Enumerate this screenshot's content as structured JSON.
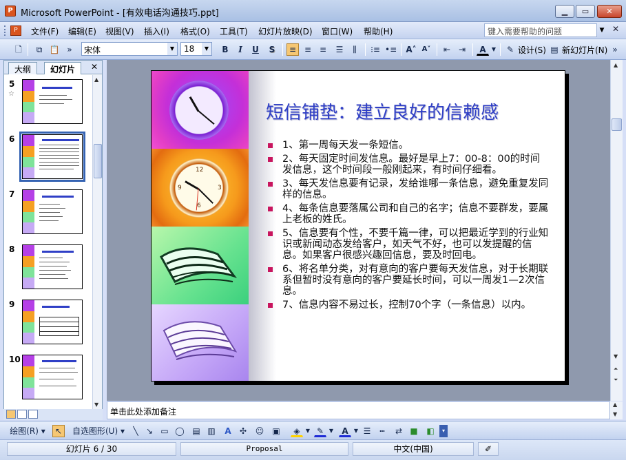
{
  "window": {
    "app_name": "Microsoft PowerPoint",
    "title": "Microsoft PowerPoint - [有效电话沟通技巧.ppt]",
    "minimize_glyph": "▁",
    "maximize_glyph": "▭",
    "close_glyph": "✕"
  },
  "menu": {
    "items": [
      "文件(F)",
      "编辑(E)",
      "视图(V)",
      "插入(I)",
      "格式(O)",
      "工具(T)",
      "幻灯片放映(D)",
      "窗口(W)",
      "帮助(H)"
    ],
    "help_placeholder": "键入需要帮助的问题",
    "close_glyph": "✕"
  },
  "toolbar": {
    "font_name": "宋体",
    "font_size": "18",
    "bold": "B",
    "italic": "I",
    "underline": "U",
    "shadow": "S",
    "design_label": "设计(S)",
    "new_slide_label": "新幻灯片(N)"
  },
  "left_pane": {
    "tab_outline": "大纲",
    "tab_slides": "幻灯片",
    "close_glyph": "✕",
    "thumbnails": [
      {
        "number": "5",
        "star": "☆"
      },
      {
        "number": "6",
        "star": ""
      },
      {
        "number": "7",
        "star": ""
      },
      {
        "number": "8",
        "star": ""
      },
      {
        "number": "9",
        "star": ""
      },
      {
        "number": "10",
        "star": ""
      }
    ],
    "selected_number": "6"
  },
  "slide": {
    "title": "短信铺垫：建立良好的信赖感",
    "bullets": [
      "1、第一周每天发一条短信。",
      "2、每天固定时间发信息。最好是早上7：00-8：00的时间发信息，这个时间段一般刚起来，有时间仔细看。",
      "3、每天发信息要有记录，发给谁哪一条信息，避免重复发同样的信息。",
      "4、每条信息要落属公司和自己的名字；信息不要群发，要属上老板的姓氏。",
      "5、信息要有个性，不要千篇一律，可以把最近学到的行业知识或新闻动态发给客户，如天气不好，也可以发提醒的信息。如果客户很感兴趣回信息，要及时回电。",
      "6、将名单分类，对有意向的客户要每天发信息，对于长期联系但暂时没有意向的客户要延长时间，可以一周发1—2次信息。",
      "7、信息内容不易过长，控制70个字（一条信息）以内。"
    ],
    "colors": {
      "title": "#2f3fc6",
      "bullet": "#c8155e"
    }
  },
  "notes": {
    "placeholder": "单击此处添加备注"
  },
  "drawing_toolbar": {
    "draw_label": "绘图(R)",
    "autoshapes_label": "自选图形(U)"
  },
  "status": {
    "slide_indicator": "幻灯片 6 / 30",
    "design_name": "Proposal",
    "language": "中文(中国)"
  }
}
